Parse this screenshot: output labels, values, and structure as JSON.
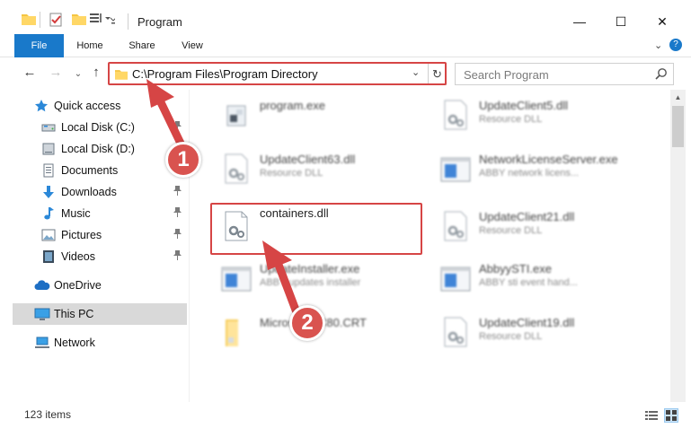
{
  "window": {
    "title": "Program",
    "controls": {
      "minimize": "—",
      "maximize": "☐",
      "close": "✕"
    }
  },
  "ribbon": {
    "tabs": [
      {
        "label": "File",
        "active": true
      },
      {
        "label": "Home"
      },
      {
        "label": "Share"
      },
      {
        "label": "View"
      }
    ],
    "expand": "⌄",
    "help": "?"
  },
  "nav": {
    "back": "←",
    "forward": "→",
    "recent": "⌄",
    "up": "↑",
    "address": "C:\\Program Files\\Program Directory",
    "address_dropdown": "⌄",
    "refresh": "↻",
    "search_placeholder": "Search Program"
  },
  "sidebar": {
    "items": [
      {
        "label": "Quick access",
        "icon": "star-icon",
        "pinned": false
      },
      {
        "label": "Local Disk (C:)",
        "icon": "drive-icon",
        "pinned": true
      },
      {
        "label": "Local Disk (D:)",
        "icon": "drive-icon",
        "pinned": false
      },
      {
        "label": "Documents",
        "icon": "documents-icon",
        "pinned": true
      },
      {
        "label": "Downloads",
        "icon": "download-icon",
        "pinned": true
      },
      {
        "label": "Music",
        "icon": "music-icon",
        "pinned": true
      },
      {
        "label": "Pictures",
        "icon": "pictures-icon",
        "pinned": true
      },
      {
        "label": "Videos",
        "icon": "videos-icon",
        "pinned": true
      },
      {
        "label": "OneDrive",
        "icon": "cloud-icon",
        "pinned": false
      },
      {
        "label": "This PC",
        "icon": "computer-icon",
        "pinned": false,
        "selected": true
      },
      {
        "label": "Network",
        "icon": "network-icon",
        "pinned": false
      }
    ],
    "pin_glyph": "📌"
  },
  "files": [
    {
      "name": "program.exe",
      "desc": "",
      "icon": "program-exe-icon"
    },
    {
      "name": "UpdateClient5.dll",
      "desc": "Resource DLL",
      "icon": "dll-gear-icon"
    },
    {
      "name": "UpdateClient63.dll",
      "desc": "Resource DLL",
      "icon": "dll-gear-icon"
    },
    {
      "name": "NetworkLicenseServer.exe",
      "desc": "ABBY network licens...",
      "icon": "exe-window-icon"
    },
    {
      "name": "containers.dll",
      "desc": "",
      "icon": "dll-gear-icon"
    },
    {
      "name": "UpdateClient21.dll",
      "desc": "Resource DLL",
      "icon": "dll-gear-icon"
    },
    {
      "name": "UpdateInstaller.exe",
      "desc": "ABBY updates installer",
      "icon": "exe-window-icon"
    },
    {
      "name": "AbbyySTI.exe",
      "desc": "ABBY sti event hand...",
      "icon": "exe-window-icon"
    },
    {
      "name": "Microsoft.VC80.CRT",
      "desc": "",
      "icon": "folder-icon"
    },
    {
      "name": "UpdateClient19.dll",
      "desc": "Resource DLL",
      "icon": "dll-gear-icon"
    }
  ],
  "status": {
    "item_count": "123 items"
  },
  "annotations": {
    "step1": "1",
    "step2": "2",
    "color": "#d64545"
  },
  "colors": {
    "file_tab": "#1979ca",
    "selection": "#d9d9d9",
    "highlight": "#d64545"
  }
}
